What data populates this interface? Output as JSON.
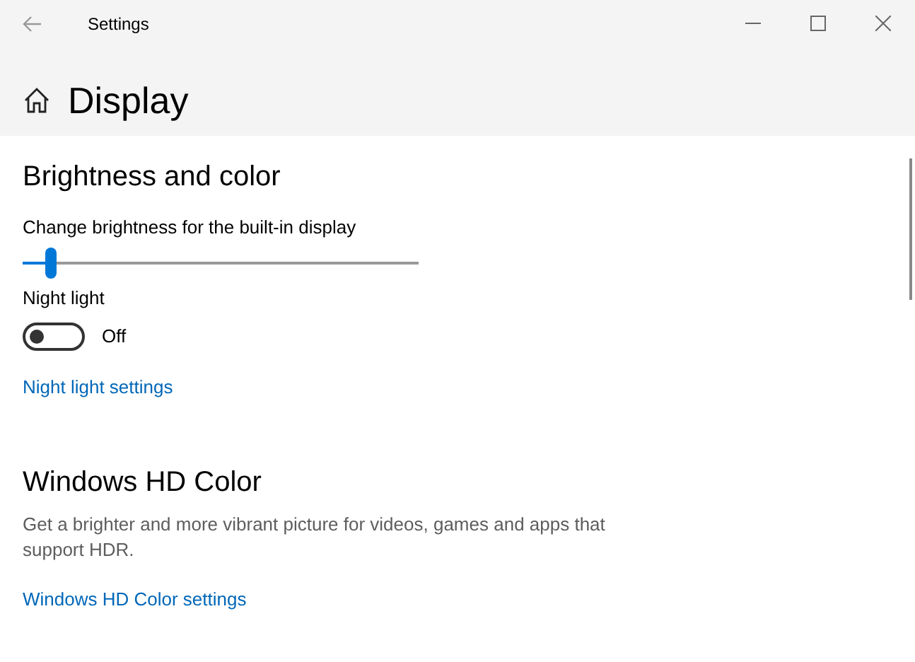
{
  "window": {
    "title": "Settings"
  },
  "page": {
    "title": "Display"
  },
  "sections": [
    {
      "heading": "Brightness and color",
      "items": [
        {
          "kind": "slider",
          "label": "Change brightness for the built-in display",
          "level": 0.07
        },
        {
          "kind": "toggle",
          "label": "Night light",
          "on": false,
          "state_text": "Off"
        },
        {
          "kind": "link",
          "label": "Night light settings"
        }
      ]
    },
    {
      "heading": "Windows HD Color",
      "items": [
        {
          "kind": "text",
          "label": "Get a brighter and more vibrant picture for videos, games and apps that support HDR."
        },
        {
          "kind": "link",
          "label": "Windows HD Color settings"
        }
      ]
    }
  ]
}
